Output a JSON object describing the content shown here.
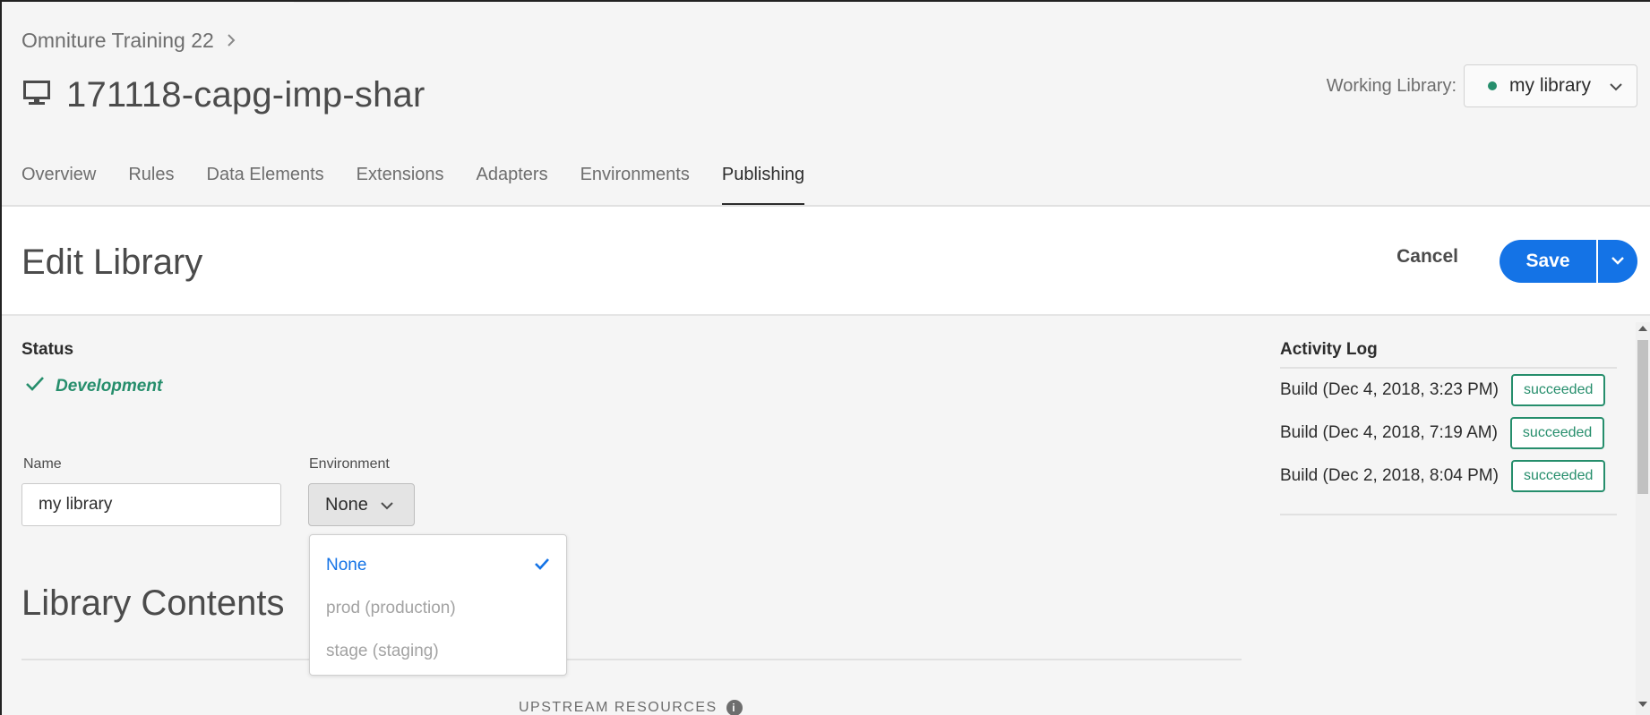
{
  "header": {
    "breadcrumb": "Omniture Training 22",
    "property_icon": "monitor-icon",
    "property_title": "171118-capg-imp-shar",
    "working_library_label": "Working Library:",
    "working_library_value": "my library",
    "working_library_status_color": "#268e6c"
  },
  "tabs": [
    {
      "label": "Overview"
    },
    {
      "label": "Rules"
    },
    {
      "label": "Data Elements"
    },
    {
      "label": "Extensions"
    },
    {
      "label": "Adapters"
    },
    {
      "label": "Environments"
    },
    {
      "label": "Publishing",
      "active": true
    }
  ],
  "edit_bar": {
    "heading": "Edit Library",
    "cancel_label": "Cancel",
    "save_label": "Save",
    "accent_color": "#1473e6"
  },
  "status": {
    "label": "Status",
    "value": "Development",
    "color": "#268e6c"
  },
  "form": {
    "name_label": "Name",
    "name_value": "my library",
    "environment_label": "Environment",
    "environment_value": "None",
    "environment_options": [
      {
        "label": "None",
        "selected": true
      },
      {
        "label": "prod (production)"
      },
      {
        "label": "stage (staging)"
      }
    ]
  },
  "library_contents": {
    "heading": "Library Contents",
    "upstream_label": "UPSTREAM RESOURCES"
  },
  "activity_log": {
    "heading": "Activity Log",
    "items": [
      {
        "text": "Build (Dec 4, 2018, 3:23 PM)",
        "badge": "succeeded"
      },
      {
        "text": "Build (Dec 4, 2018, 7:19 AM)",
        "badge": "succeeded"
      },
      {
        "text": "Build (Dec 2, 2018, 8:04 PM)",
        "badge": "succeeded"
      }
    ]
  }
}
